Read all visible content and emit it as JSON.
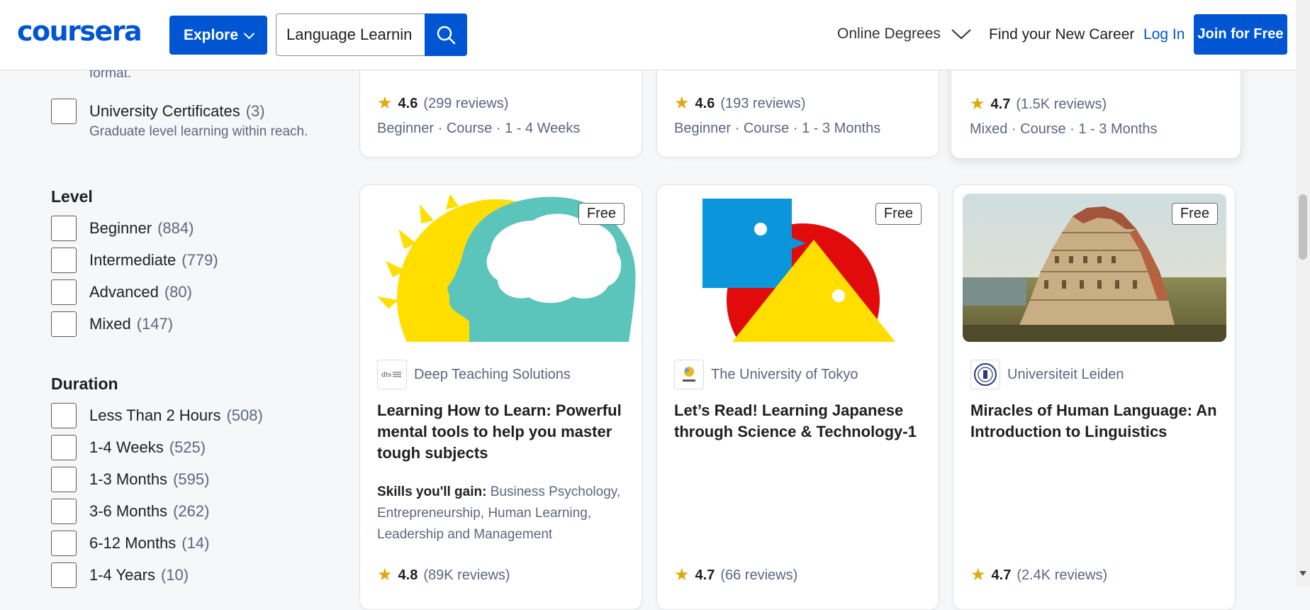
{
  "header": {
    "logo": "coursera",
    "explore_label": "Explore",
    "search_value": "Language Learnin",
    "nav_degrees": "Online Degrees",
    "nav_career": "Find your New Career",
    "login": "Log In",
    "join": "Join for Free"
  },
  "sidebar": {
    "cut_text": "format.",
    "univ_cert_label": "University Certificates",
    "univ_cert_count": "(3)",
    "univ_cert_desc": "Graduate level learning within reach.",
    "level_heading": "Level",
    "levels": [
      {
        "label": "Beginner",
        "count": "(884)"
      },
      {
        "label": "Intermediate",
        "count": "(779)"
      },
      {
        "label": "Advanced",
        "count": "(80)"
      },
      {
        "label": "Mixed",
        "count": "(147)"
      }
    ],
    "duration_heading": "Duration",
    "durations": [
      {
        "label": "Less Than 2 Hours",
        "count": "(508)"
      },
      {
        "label": "1-4 Weeks",
        "count": "(525)"
      },
      {
        "label": "1-3 Months",
        "count": "(595)"
      },
      {
        "label": "3-6 Months",
        "count": "(262)"
      },
      {
        "label": "6-12 Months",
        "count": "(14)"
      },
      {
        "label": "1-4 Years",
        "count": "(10)"
      }
    ]
  },
  "top_cards": [
    {
      "score": "4.6",
      "reviews": "(299 reviews)",
      "meta": "Beginner · Course · 1 - 4 Weeks"
    },
    {
      "score": "4.6",
      "reviews": "(193 reviews)",
      "meta": "Beginner · Course · 1 - 3 Months"
    },
    {
      "score": "4.7",
      "reviews": "(1.5K reviews)",
      "meta": "Mixed · Course · 1 - 3 Months"
    }
  ],
  "cards": [
    {
      "badge": "Free",
      "partner": "Deep Teaching Solutions",
      "title": "Learning How to Learn: Powerful mental tools to help you master tough subjects",
      "skills_label": "Skills you'll gain:",
      "skills": "Business Psychology, Entrepreneurship, Human Learning, Leadership and Management",
      "score": "4.8",
      "reviews": "(89K reviews)"
    },
    {
      "badge": "Free",
      "partner": "The University of Tokyo",
      "title": "Let’s Read! Learning Japanese through Science & Technology-1",
      "score": "4.7",
      "reviews": "(66 reviews)"
    },
    {
      "badge": "Free",
      "partner": "Universiteit Leiden",
      "title": "Miracles of Human Language: An Introduction to Linguistics",
      "score": "4.7",
      "reviews": "(2.4K reviews)"
    }
  ],
  "colors": {
    "brand": "#0056d2",
    "star": "#e0a80b",
    "muted_text": "#5b6780",
    "page_bg": "#f5f7f8"
  },
  "icons": {
    "search": "search-icon",
    "star": "star-icon",
    "chevron": "chevron-down-icon"
  }
}
